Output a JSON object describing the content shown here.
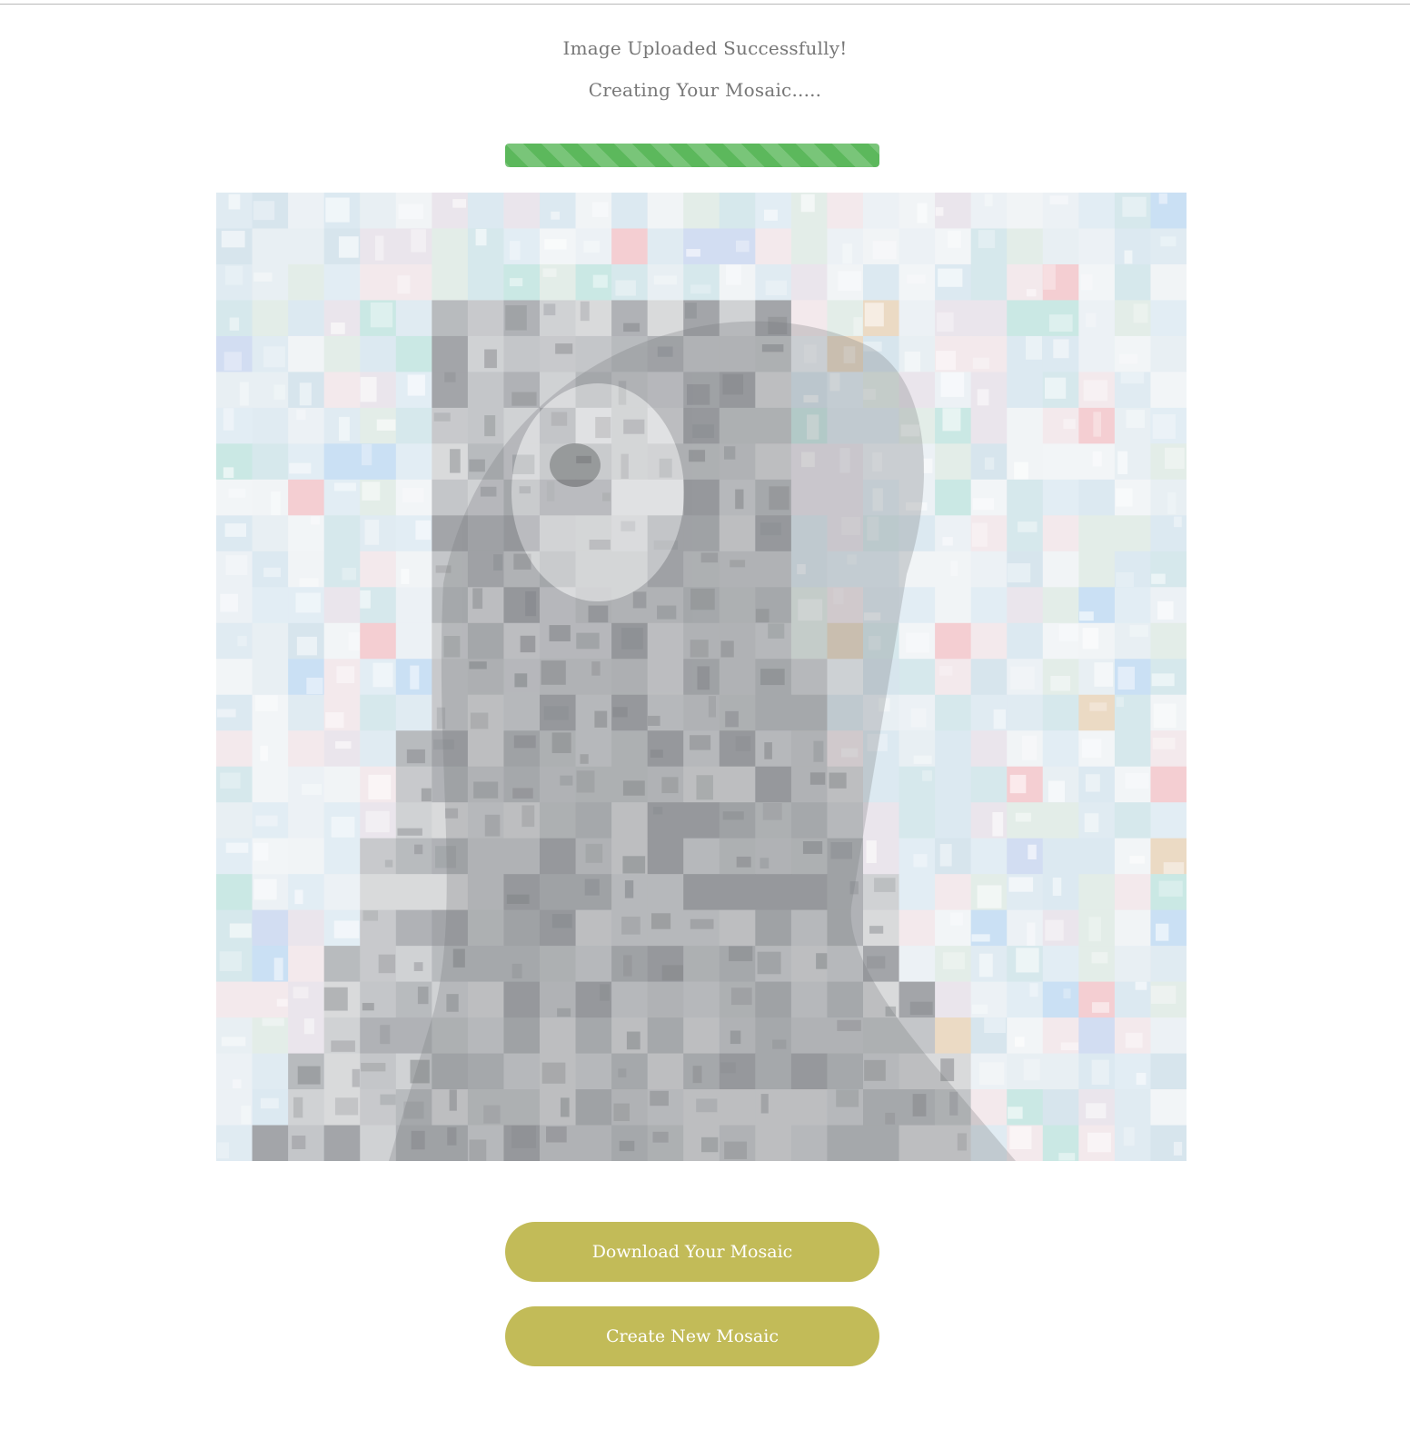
{
  "status": {
    "uploaded_text": "Image Uploaded Successfully!",
    "creating_text": "Creating Your Mosaic....."
  },
  "progress": {
    "percent": 100,
    "color": "#5cb85c"
  },
  "mosaic": {
    "grid_columns": 27,
    "grid_rows": 27
  },
  "actions": {
    "download_label": "Download Your Mosaic",
    "create_label": "Create New Mosaic",
    "button_color": "#c2bb58"
  }
}
